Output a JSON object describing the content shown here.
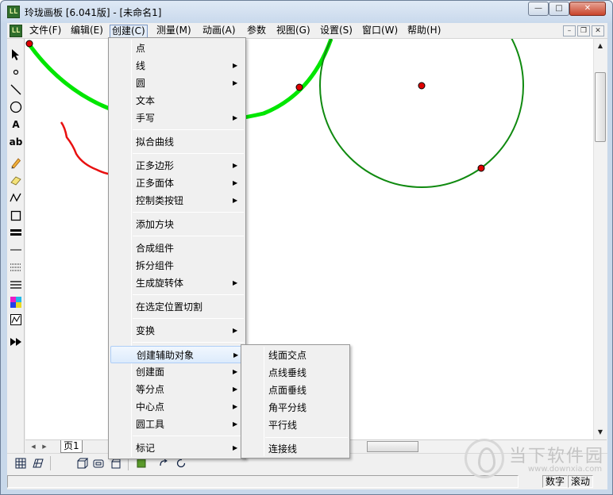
{
  "window": {
    "title": "玲珑画板 [6.041版] - [未命名1]",
    "icon_text": "LL",
    "buttons": {
      "minimize": "—",
      "maximize": "□",
      "close": "✕"
    }
  },
  "menubar": {
    "items": [
      "文件(F)",
      "编辑(E)",
      "创建(C)",
      "测量(M)",
      "动画(A)",
      "参数",
      "视图(G)",
      "设置(S)",
      "窗口(W)",
      "帮助(H)"
    ],
    "active_index": 2,
    "mdi_buttons": {
      "minimize": "–",
      "restore": "❐",
      "close": "✕"
    }
  },
  "create_menu": {
    "items": [
      {
        "label": "点",
        "submenu": false
      },
      {
        "label": "线",
        "submenu": true
      },
      {
        "label": "圆",
        "submenu": true
      },
      {
        "label": "文本",
        "submenu": false
      },
      {
        "label": "手写",
        "submenu": true
      },
      {
        "label": "拟合曲线",
        "submenu": false
      },
      {
        "label": "正多边形",
        "submenu": true
      },
      {
        "label": "正多面体",
        "submenu": true
      },
      {
        "label": "控制类按钮",
        "submenu": true
      },
      {
        "label": "添加方块",
        "submenu": false
      },
      {
        "label": "合成组件",
        "submenu": false
      },
      {
        "label": "拆分组件",
        "submenu": false
      },
      {
        "label": "生成旋转体",
        "submenu": true
      },
      {
        "label": "在选定位置切割",
        "submenu": false
      },
      {
        "label": "变换",
        "submenu": true
      },
      {
        "label": "创建辅助对象",
        "submenu": true
      },
      {
        "label": "创建面",
        "submenu": true
      },
      {
        "label": "等分点",
        "submenu": true
      },
      {
        "label": "中心点",
        "submenu": true
      },
      {
        "label": "圆工具",
        "submenu": true
      },
      {
        "label": "标记",
        "submenu": true
      }
    ],
    "highlighted": "创建辅助对象",
    "submenu_glyph": "▶"
  },
  "aux_submenu": {
    "items": [
      "线面交点",
      "点线垂线",
      "点面垂线",
      "角平分线",
      "平行线",
      "连接线"
    ]
  },
  "toolbox": {
    "tools": [
      "pointer",
      "point",
      "line",
      "circle",
      "text-A",
      "text-ab",
      "pencil",
      "eraser",
      "polyline",
      "rectangle",
      "thick-line",
      "thin-line",
      "dotted-line",
      "multi-line",
      "color-palette",
      "graph",
      "fast-forward"
    ],
    "text_A": "A",
    "text_ab": "ab"
  },
  "tabbar": {
    "page_label": "页1"
  },
  "statusbar": {
    "num": "数字",
    "scroll": "滚动"
  },
  "watermark": {
    "text": "当下软件园",
    "url": "www.downxia.com"
  },
  "colors": {
    "accent_green": "#00e600",
    "circle_green": "#108a10",
    "point_red": "#e00000",
    "stroke_red": "#e81010",
    "menu_highlight": "#dcebfc"
  }
}
